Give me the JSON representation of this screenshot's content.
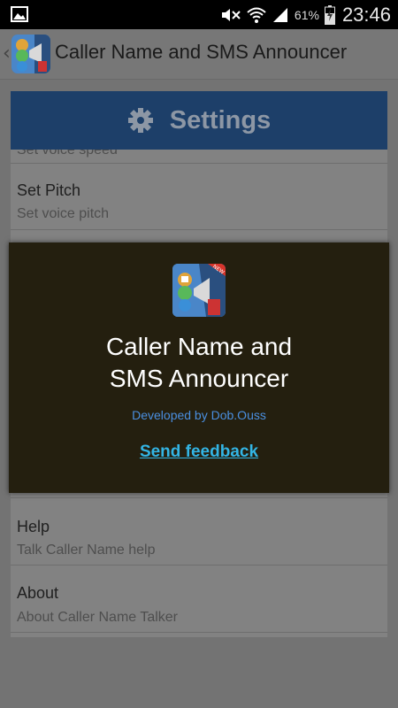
{
  "status_bar": {
    "battery_percent": "61%",
    "time": "23:46",
    "icons": [
      "gallery-icon",
      "mute-icon",
      "wifi-icon",
      "signal-icon",
      "battery-charging-icon"
    ]
  },
  "action_bar": {
    "title": "Caller Name and SMS Announcer",
    "icon": "app-icon",
    "back_glyph": "‹"
  },
  "settings": {
    "header_label": "Settings",
    "header_icon": "gear-icon",
    "items": [
      {
        "title": "",
        "summary": "Set voice speed"
      },
      {
        "title": "Set Pitch",
        "summary": "Set voice pitch"
      },
      {
        "title": "Help",
        "summary": "Talk Caller Name help"
      },
      {
        "title": "About",
        "summary": "About Caller Name Talker"
      }
    ]
  },
  "dialog": {
    "app_name_line1": "Caller Name and",
    "app_name_line2": "SMS Announcer",
    "developer": "Developed by Dob.Ouss",
    "feedback_link": "Send feedback",
    "badge": "NEW"
  },
  "colors": {
    "header_bg": "#1d3f69",
    "dialog_bg": "#241f0f",
    "link": "#33b5e5",
    "developer_text": "#4a8fe0"
  }
}
